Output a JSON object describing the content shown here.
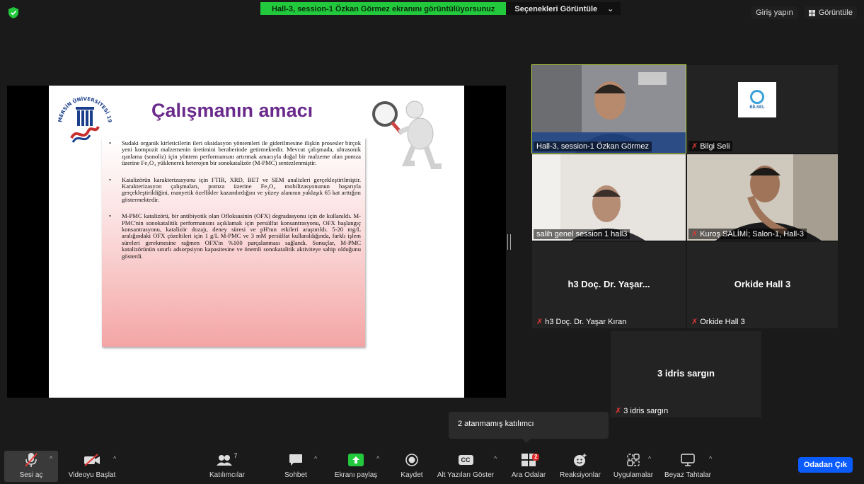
{
  "top_bar": {
    "share_text": "Hall-3, session-1 Özkan Görmez ekranını görüntülüyorsunuz",
    "options_label": "Seçenekleri Görüntüle",
    "options_chevron": "⌄",
    "signin_label": "Giriş yapın",
    "view_label": "Görüntüle"
  },
  "slide": {
    "title": "Çalışmanın amacı",
    "bullets": [
      "Sudaki organik kirleticilerin ileri oksidasyon yöntemleri ile giderilmesine ilişkin prosesler birçok yeni kompozit malzemenin üretimini beraberinde getirmektedir. Mevcut çalışmada, ultrasonik ışınlama (sonoliz) için yöntem performansını artırmak amacıyla doğal bir malzeme olan pomza üzerine Fe₃O₄ yüklenerek heterojen bir sonokatalizör (M-PMC) sentezlenmiştir.",
      "Katalizörün karakterizasyonu için FTIR, XRD, BET ve SEM analizleri gerçekleştirilmiştir. Karakterizasyon çalışmaları, pomza üzerine Fe₃O₄ mobilizasyonunun başarıyla gerçekleştirildiğini, manyetik özellikler kazandırdığını ve yüzey alanının yaklaşık 65 kat arttığını göstermektedir.",
      "M-PMC katalizörü, bir antibiyotik olan Ofloksasinin (OFX) degradasyonu için de kullanıldı. M-PMC'nin sonokatalitik performansını açıklamak için persülfat konsantrasyonu, OFX başlangıç konsantrasyonu, katalizör dozajı, deney süresi ve pH'nın etkileri araştırıldı. 5-20 mg/L aralığındaki OFX çözeltileri için 1 g/L M-PMC ve 3 mM persülfat kullanıldığında, farklı işlem süreleri gerekmesine rağmen OFX'in %100 parçalanması sağlandı. Sonuçlar, M-PMC katalizörünün sınırlı adsorpsiyon kapasitesine ve önemli sonokatalitik aktiviteye sahip olduğunu gösterdi."
    ],
    "logo_text": "MERSİN ÜNİVERSİTESİ 1992"
  },
  "participants": [
    {
      "name": "Hall-3, session-1 Özkan Görmez",
      "muted": false,
      "active": true
    },
    {
      "name": "Bilgi Seli",
      "muted": true,
      "logo_text": "BİLSEL"
    },
    {
      "name": "salih genel session 1 hall3",
      "muted": false
    },
    {
      "name": "Kuroş SALİMİ; Salon-1, Hall-3",
      "muted": true
    },
    {
      "name": "h3 Doç. Dr. Yaşar Kıran",
      "display": "h3 Doç. Dr. Yaşar...",
      "muted": true
    },
    {
      "name": "Orkide Hall 3",
      "display": "Orkide Hall 3",
      "muted": true
    },
    {
      "name": "3 idris sargın",
      "display": "3 idris sargın",
      "muted": true
    }
  ],
  "popup": {
    "text": "2 atanmamış katılımcı"
  },
  "toolbar": {
    "mic": "Sesi aç",
    "video": "Videoyu Başlat",
    "participants": "Katılımcılar",
    "participants_count": "7",
    "chat": "Sohbet",
    "share": "Ekranı paylaş",
    "record": "Kaydet",
    "captions": "Alt Yazıları Göster",
    "captions_icon_text": "CC",
    "breakout": "Ara Odalar",
    "breakout_badge": "2",
    "reactions": "Reaksiyonlar",
    "apps": "Uygulamalar",
    "whiteboard": "Beyaz Tahtalar",
    "leave": "Odadan Çık",
    "caret": "^"
  },
  "colors": {
    "share_banner": "#23c93c",
    "active_speaker": "#c3df4a",
    "leave_button": "#0b5cff",
    "slide_title": "#6a2a8c",
    "muted_mic": "#e53935"
  }
}
